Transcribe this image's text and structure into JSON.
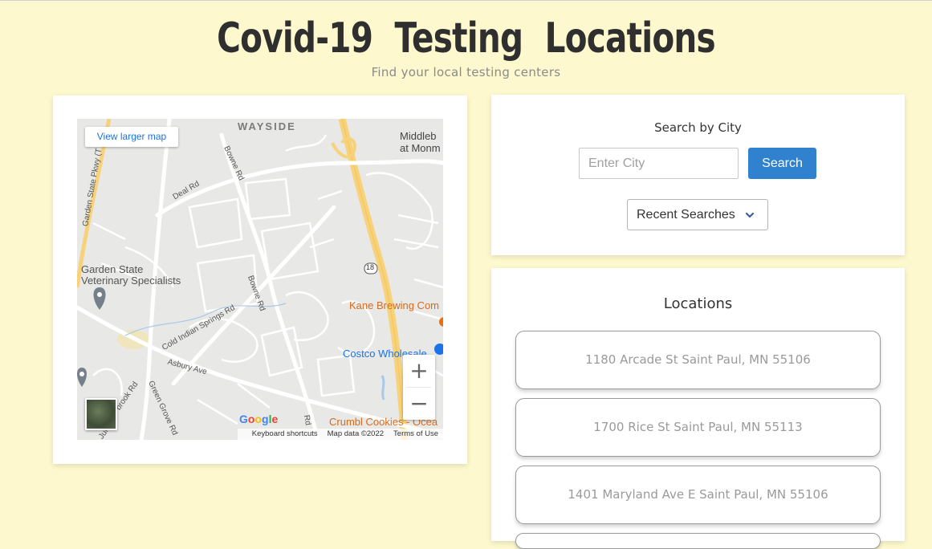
{
  "header": {
    "title": "Covid-19 Testing Locations",
    "subtitle": "Find your local testing centers"
  },
  "map": {
    "view_larger_label": "View larger map",
    "zoom_in_label": "+",
    "zoom_out_label": "−",
    "keyboard_shortcuts": "Keyboard shortcuts",
    "map_data": "Map data ©2022",
    "terms": "Terms of Use",
    "labels": {
      "wayside": "WAYSIDE",
      "middlebrook": "Middleb",
      "middlebrook2": "at Monm",
      "garden_state_pkwy": "Garden State Pkwy (T",
      "deal_rd": "Deal Rd",
      "bowne_rd_top": "Bowne Rd",
      "bowne_rd_mid": "Bowne Rd",
      "vet_line1": "Garden State",
      "vet_line2": "Veterinary Specialists",
      "route18": "18",
      "kane": "Kane Brewing Com",
      "cold_indian": "Cold Indian Springs Rd",
      "asbury": "Asbury Ave",
      "costco": "Costco Wholesale",
      "green_grove": "Green Grove Rd",
      "brook_rd": "brook Rd",
      "jun": "Jun",
      "rd": "Rd",
      "crumbl": "Crumbl Cookies - Ocea"
    },
    "icons": [
      "map-pin-icon",
      "satellite-view-icon",
      "google-logo"
    ]
  },
  "search": {
    "heading": "Search by City",
    "placeholder": "Enter City",
    "button_label": "Search",
    "recent_label": "Recent Searches"
  },
  "locations": {
    "heading": "Locations",
    "items": [
      "1180 Arcade St Saint Paul, MN 55106",
      "1700 Rice St Saint Paul, MN 55113",
      "1401 Maryland Ave E Saint Paul, MN 55106"
    ]
  },
  "colors": {
    "background": "#fdf8cd",
    "accent": "#3182ce",
    "title": "#2f2f2f"
  }
}
